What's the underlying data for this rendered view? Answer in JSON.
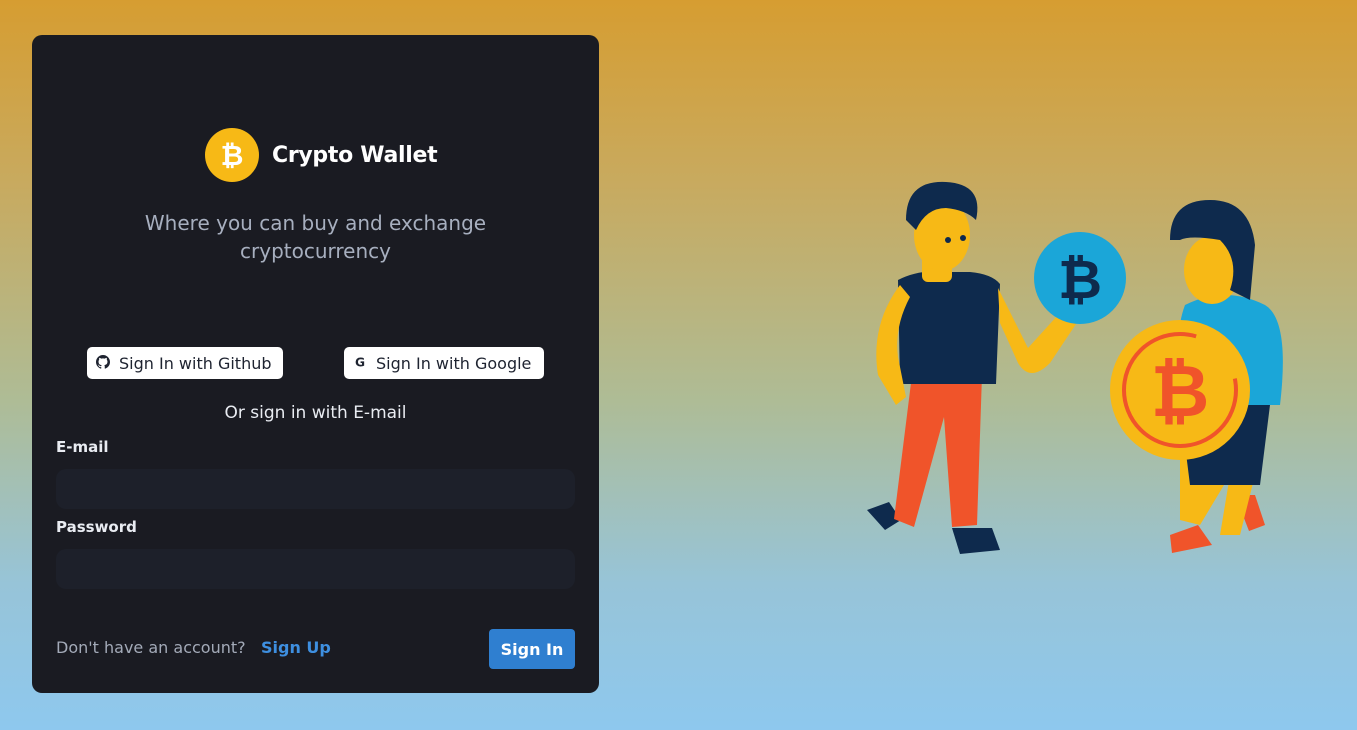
{
  "brand": {
    "name": "Crypto Wallet",
    "logo_icon": "bitcoin-icon",
    "logo_color": "#f7b916"
  },
  "tagline": {
    "line1": "Where you can buy and exchange",
    "line2": "cryptocurrency"
  },
  "oauth": {
    "github_label": "Sign In with Github",
    "github_icon": "github-icon",
    "google_label": "Sign In with Google",
    "google_icon": "google-icon"
  },
  "divider_text": "Or sign in with E-mail",
  "form": {
    "email_label": "E-mail",
    "email_value": "",
    "password_label": "Password",
    "password_value": ""
  },
  "footer": {
    "prompt": "Don't have an account?",
    "signup_label": "Sign Up"
  },
  "submit_label": "Sign In",
  "colors": {
    "accent": "#2f7fd0",
    "link": "#3e8fe0",
    "card_bg": "#1a1b22"
  }
}
